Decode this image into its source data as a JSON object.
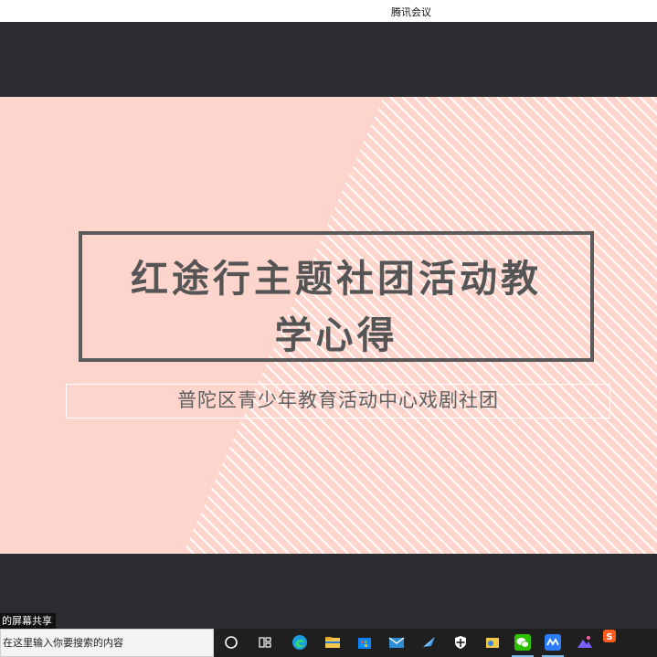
{
  "window": {
    "title": "腾讯会议"
  },
  "slide": {
    "title_line1": "红途行主题社团活动教",
    "title_line2": "学心得",
    "subtitle": "普陀区青少年教育活动中心戏剧社团"
  },
  "share_label": "的屏幕共享",
  "taskbar": {
    "search_placeholder": "在这里输入你要搜索的内容"
  },
  "colors": {
    "slide_bg": "#fdd5cc",
    "stripe": "#ffffff",
    "title_text": "#555555",
    "stage_bg": "#2b2d30"
  }
}
